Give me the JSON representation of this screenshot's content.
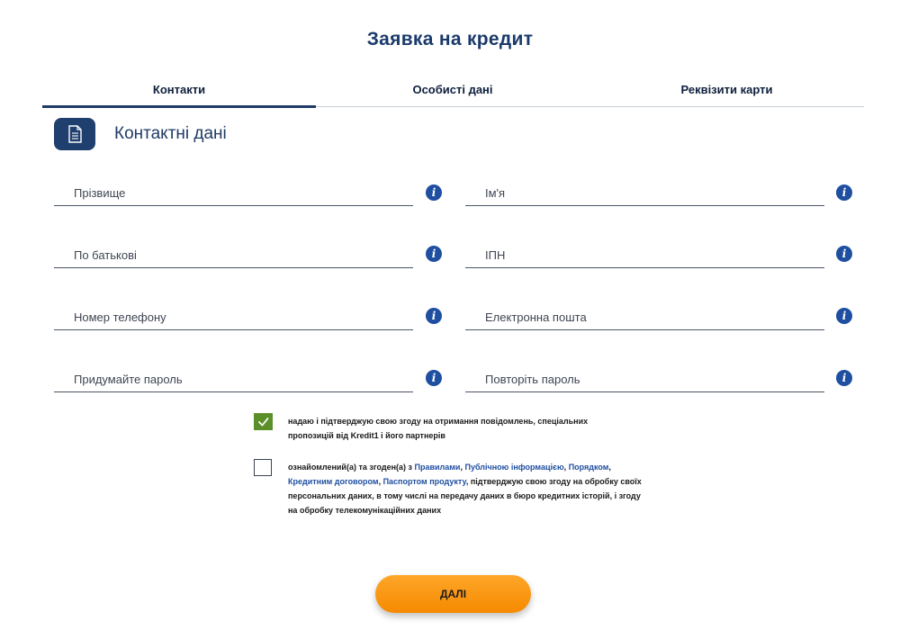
{
  "page": {
    "title": "Заявка на кредит"
  },
  "tabs": [
    {
      "label": "Контакти",
      "active": true
    },
    {
      "label": "Особисті дані",
      "active": false
    },
    {
      "label": "Реквізити карти",
      "active": false
    }
  ],
  "section": {
    "title": "Контактні дані",
    "icon": "document-icon"
  },
  "fields": {
    "surname": {
      "placeholder": "Прізвище",
      "value": ""
    },
    "name": {
      "placeholder": "Ім'я",
      "value": ""
    },
    "patronymic": {
      "placeholder": "По батькові",
      "value": ""
    },
    "tax_id": {
      "placeholder": "ІПН",
      "value": ""
    },
    "phone": {
      "placeholder": "Номер телефону",
      "value": ""
    },
    "email": {
      "placeholder": "Електронна пошта",
      "value": ""
    },
    "password": {
      "placeholder": "Придумайте пароль",
      "value": ""
    },
    "password_repeat": {
      "placeholder": "Повторіть пароль",
      "value": ""
    }
  },
  "info_icon": "info-icon",
  "consents": {
    "marketing": {
      "checked": true,
      "line1": "надаю і підтверджую свою згоду на отримання повідомлень, спеціальних",
      "line2": "пропозицій від Kredit1 і його партнерів"
    },
    "terms": {
      "checked": false,
      "prefix": "ознайомлений(а) та згоден(а) з ",
      "link_rules": "Правилами",
      "sep1": ", ",
      "link_public_info": "Публічною інформацією",
      "sep2": ",",
      "link_procedure": "Порядком",
      "sep3": ", ",
      "link_credit_agreement": "Кредитним договором",
      "sep4": ", ",
      "link_product_passport": "Паспортом продукту",
      "suffix": ", підтверджую свою згоду на обробку своїх персональних даних, в тому числі на передачу даних в бюро кредитних історій, і згоду на обробку телекомунікаційних даних"
    }
  },
  "submit": {
    "label": "ДАЛІ"
  },
  "colors": {
    "accent": "#1f3a66",
    "button": "#f7931e",
    "check": "#5a8f2a",
    "link": "#1f4fa0"
  }
}
